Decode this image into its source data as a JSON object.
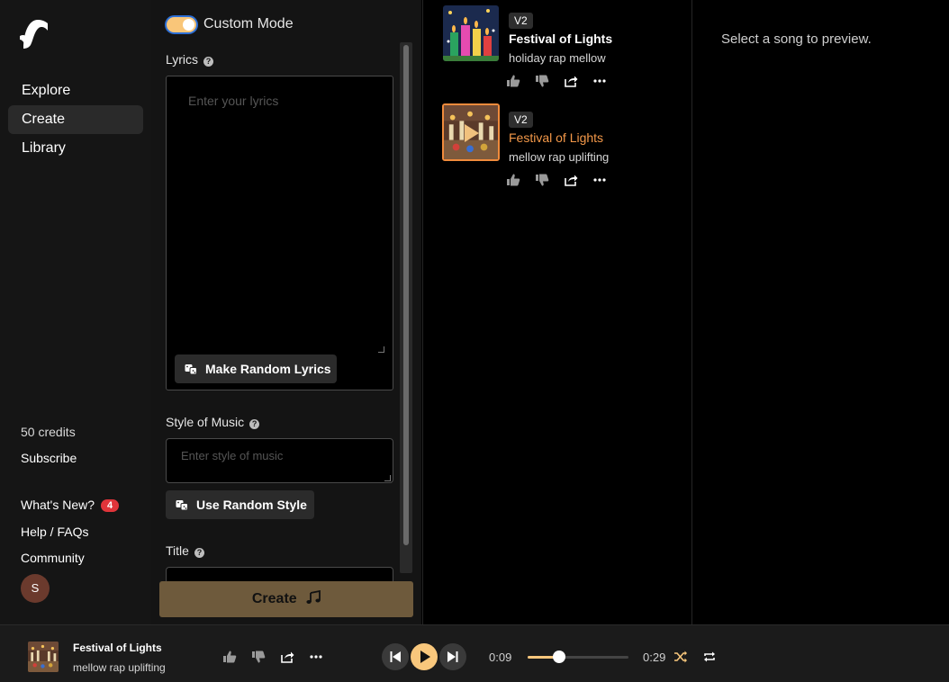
{
  "sidebar": {
    "nav": [
      {
        "label": "Explore",
        "active": false
      },
      {
        "label": "Create",
        "active": true
      },
      {
        "label": "Library",
        "active": false
      }
    ],
    "credits": "50 credits",
    "subscribe": "Subscribe",
    "whats_new": "What's New?",
    "whats_new_badge": "4",
    "help": "Help / FAQs",
    "community": "Community",
    "avatar_initial": "S"
  },
  "create": {
    "custom_mode_label": "Custom Mode",
    "custom_mode_on": true,
    "lyrics_label": "Lyrics",
    "lyrics_placeholder": "Enter your lyrics",
    "random_lyrics_label": "Make Random Lyrics",
    "style_label": "Style of Music",
    "style_placeholder": "Enter style of music",
    "random_style_label": "Use Random Style",
    "title_label": "Title",
    "create_button": "Create",
    "help_glyph": "?"
  },
  "songs": [
    {
      "version": "V2",
      "title": "Festival of Lights",
      "tags": "holiday rap mellow",
      "playing": false
    },
    {
      "version": "V2",
      "title": "Festival of Lights",
      "tags": "mellow rap uplifting",
      "playing": true
    }
  ],
  "preview": {
    "message": "Select a song to preview."
  },
  "player": {
    "title": "Festival of Lights",
    "tags": "mellow rap uplifting",
    "elapsed": "0:09",
    "duration": "0:29",
    "progress": 0.31
  },
  "colors": {
    "accent": "#f8c77c",
    "playing_title": "#f39849",
    "badge": "#e0343a"
  },
  "icons": [
    "logo-icon",
    "help-icon",
    "dice-icon",
    "music-note-icon",
    "thumbs-up-icon",
    "thumbs-down-icon",
    "share-icon",
    "more-icon",
    "play-icon",
    "skip-back-icon",
    "skip-forward-icon",
    "shuffle-icon",
    "repeat-icon"
  ]
}
